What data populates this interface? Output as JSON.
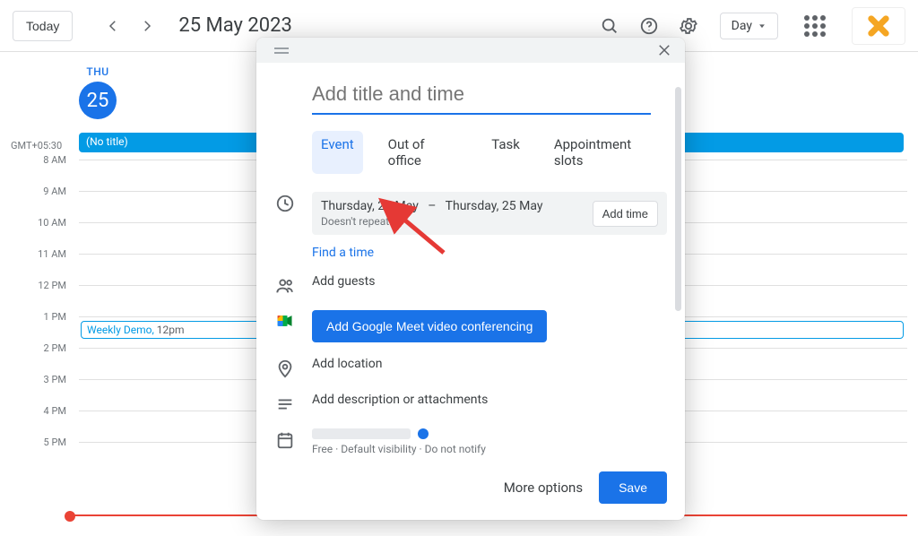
{
  "header": {
    "today_button": "Today",
    "date": "25 May 2023",
    "view_label": "Day"
  },
  "day": {
    "dow": "THU",
    "num": "25",
    "tz": "GMT+05:30"
  },
  "hours": [
    "8 AM",
    "9 AM",
    "10 AM",
    "11 AM",
    "12 PM",
    "1 PM",
    "2 PM",
    "3 PM",
    "4 PM",
    "5 PM"
  ],
  "allday_event": {
    "title": "(No title)"
  },
  "event": {
    "title": "Weekly Demo",
    "time": "12pm"
  },
  "dialog": {
    "title_placeholder": "Add title and time",
    "tabs": {
      "event": "Event",
      "ooo": "Out of office",
      "task": "Task",
      "appt": "Appointment slots"
    },
    "date_start": "Thursday, 25 May",
    "date_sep": "–",
    "date_end": "Thursday, 25 May",
    "repeat": "Doesn't repeat",
    "add_time": "Add time",
    "find_time": "Find a time",
    "add_guests": "Add guests",
    "add_meet": "Add Google Meet video conferencing",
    "add_location": "Add location",
    "add_desc": "Add description or attachments",
    "busy_dot_color": "#1a73e8",
    "meta": "Free  ·  Default visibility  ·  Do not notify",
    "more_options": "More options",
    "save": "Save"
  }
}
